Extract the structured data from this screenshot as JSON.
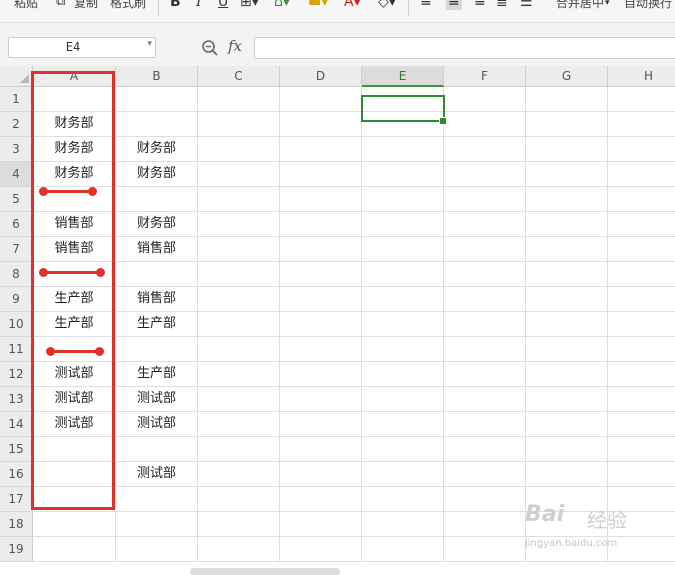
{
  "toolbar": {
    "paste_label": "粘贴",
    "copy_label": "复制",
    "format_painter_label": "格式刷",
    "bold_glyph": "B",
    "italic_glyph": "I",
    "underline_glyph": "U",
    "merge_center_label": "合并居中",
    "wrap_text_label": "自动换行"
  },
  "formula_bar": {
    "name_box_value": "E4",
    "fx_label": "fx",
    "formula_value": ""
  },
  "columns": [
    "A",
    "B",
    "C",
    "D",
    "E",
    "F",
    "G",
    "H"
  ],
  "active_column": "E",
  "active_row": 4,
  "rows": [
    {
      "num": "1",
      "a": "",
      "b": ""
    },
    {
      "num": "2",
      "a": "财务部",
      "b": ""
    },
    {
      "num": "3",
      "a": "财务部",
      "b": "财务部"
    },
    {
      "num": "4",
      "a": "财务部",
      "b": "财务部"
    },
    {
      "num": "5",
      "a": "",
      "b": ""
    },
    {
      "num": "6",
      "a": "销售部",
      "b": "财务部"
    },
    {
      "num": "7",
      "a": "销售部",
      "b": "销售部"
    },
    {
      "num": "8",
      "a": "",
      "b": ""
    },
    {
      "num": "9",
      "a": "生产部",
      "b": "销售部"
    },
    {
      "num": "10",
      "a": "生产部",
      "b": "生产部"
    },
    {
      "num": "11",
      "a": "",
      "b": ""
    },
    {
      "num": "12",
      "a": "测试部",
      "b": "生产部"
    },
    {
      "num": "13",
      "a": "测试部",
      "b": "测试部"
    },
    {
      "num": "14",
      "a": "测试部",
      "b": "测试部"
    },
    {
      "num": "15",
      "a": "",
      "b": ""
    },
    {
      "num": "16",
      "a": "",
      "b": "测试部"
    },
    {
      "num": "17",
      "a": "",
      "b": ""
    },
    {
      "num": "18",
      "a": "",
      "b": ""
    },
    {
      "num": "19",
      "a": "",
      "b": ""
    }
  ],
  "annotation_color": "#e0302a",
  "selection_color": "#2f8a2f",
  "watermark": {
    "brand": "Bai",
    "suffix": "经验",
    "url": "jingyan.baidu.com"
  }
}
